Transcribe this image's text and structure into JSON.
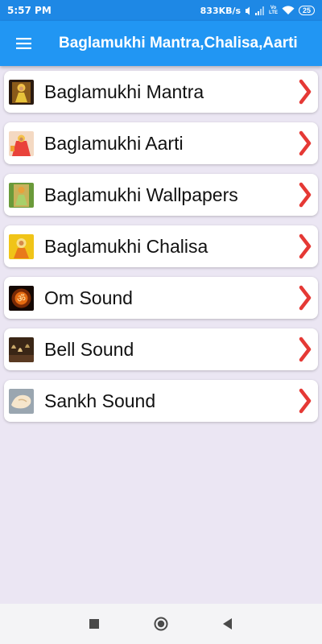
{
  "status_bar": {
    "time": "5:57 PM",
    "speed": "833KB/s",
    "volte_top": "Vo",
    "volte_bottom": "LTE",
    "battery": "25",
    "icons": [
      "mute-icon",
      "signal-icon",
      "volte-icon",
      "wifi-icon",
      "battery-icon"
    ]
  },
  "app_bar": {
    "title": "Baglamukhi Mantra,Chalisa,Aarti",
    "menu_icon": "hamburger-menu-icon",
    "color": "#2196f3"
  },
  "items": [
    {
      "label": "Baglamukhi Mantra",
      "icon": "goddess-thumbnail"
    },
    {
      "label": "Baglamukhi Aarti",
      "icon": "aarti-thumbnail"
    },
    {
      "label": "Baglamukhi Wallpapers",
      "icon": "wallpaper-thumbnail"
    },
    {
      "label": "Baglamukhi Chalisa",
      "icon": "chalisa-thumbnail"
    },
    {
      "label": "Om Sound",
      "icon": "om-thumbnail"
    },
    {
      "label": "Bell Sound",
      "icon": "bell-thumbnail"
    },
    {
      "label": "Sankh Sound",
      "icon": "conch-thumbnail"
    }
  ],
  "chevron_color": "#e53935",
  "nav_bar": {
    "icons": [
      "recents-square-icon",
      "home-circle-icon",
      "back-triangle-icon"
    ]
  }
}
